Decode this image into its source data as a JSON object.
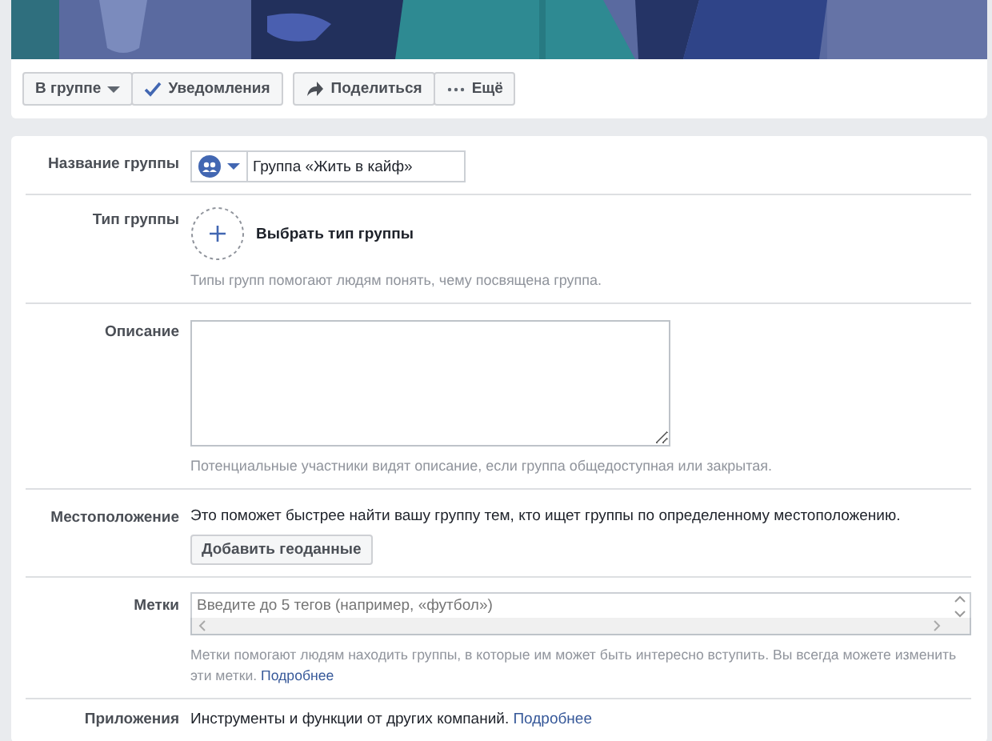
{
  "cover": {
    "kind": "illustration"
  },
  "header_buttons": [
    {
      "label": "В группе",
      "kind": "dropdown"
    },
    {
      "label": "Уведомления",
      "kind": "check"
    },
    {
      "label": "Поделиться",
      "kind": "share"
    },
    {
      "label": "Ещё",
      "kind": "more"
    }
  ],
  "settings": [
    {
      "kind": "name",
      "label": "Название группы",
      "value": "Группа «Жить в кайф»"
    },
    {
      "kind": "type",
      "label": "Тип группы",
      "action": "Выбрать тип группы",
      "hint": "Типы групп помогают людям понять, чему посвящена группа."
    },
    {
      "kind": "description",
      "label": "Описание",
      "hint": "Потенциальные участники видят описание, если группа общедоступная или закрытая."
    },
    {
      "kind": "location",
      "label": "Местоположение",
      "text": "Это поможет быстрее найти вашу группу тем, кто ищет группы по определенному местоположению.",
      "button": "Добавить геоданные"
    },
    {
      "kind": "tags",
      "label": "Метки",
      "placeholder": "Введите до 5 тегов (например, «футбол»)",
      "hint": "Метки помогают людям находить группы, в которые им может быть интересно вступить. Вы всегда можете изменить эти метки.",
      "link": "Подробнее"
    },
    {
      "kind": "apps",
      "label": "Приложения",
      "text": "Инструменты и функции от других компаний.",
      "link": "Подробнее"
    }
  ]
}
